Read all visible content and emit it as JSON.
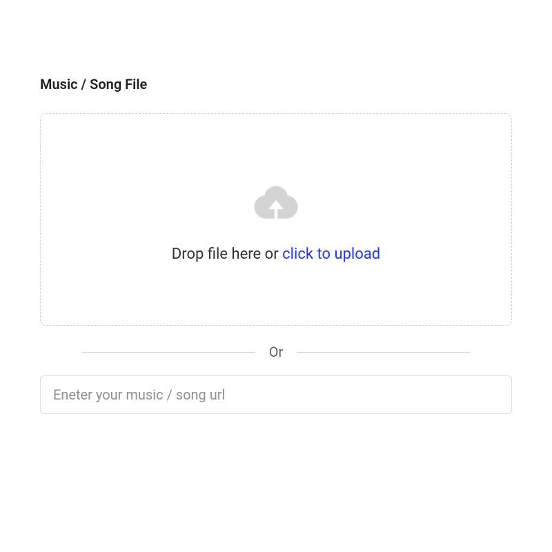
{
  "section": {
    "title": "Music / Song File"
  },
  "dropzone": {
    "text_prefix": "Drop file here or ",
    "link_text": "click to upload"
  },
  "divider": {
    "text": "Or"
  },
  "url_input": {
    "placeholder": "Eneter your music / song url",
    "value": ""
  }
}
